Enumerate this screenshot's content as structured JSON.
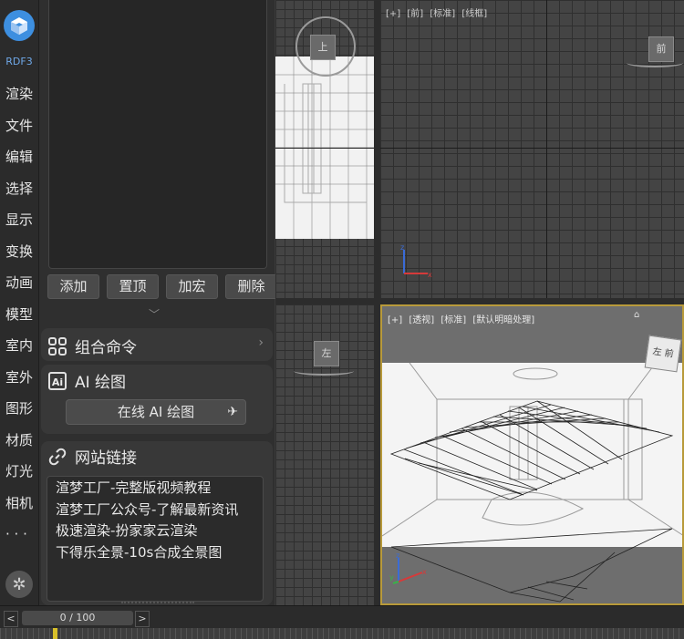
{
  "rail": {
    "version": "RDF3",
    "menu": [
      "渲染",
      "文件",
      "编辑",
      "选择",
      "显示",
      "变换",
      "动画",
      "模型",
      "室内",
      "室外",
      "图形",
      "材质",
      "灯光",
      "相机",
      "· · ·"
    ]
  },
  "panel": {
    "buttons": [
      "添加",
      "置顶",
      "加宏",
      "删除"
    ],
    "combo": {
      "title": "组合命令"
    },
    "ai": {
      "title": "AI 绘图",
      "badge": "Ai",
      "online_button": "在线 AI 绘图"
    },
    "links": {
      "title": "网站链接",
      "items": [
        "渲梦工厂-完整版视频教程",
        "渲梦工厂公众号-了解最新资讯",
        "极速渲染-扮家家云渲染",
        "下得乐全景-10s合成全景图"
      ]
    }
  },
  "viewports": {
    "top_right": {
      "labels": [
        "[+]",
        "[前]",
        "[标准]",
        "[线框]"
      ],
      "cube_label": "前"
    },
    "bottom_right": {
      "labels": [
        "[+]",
        "[透视]",
        "[标准]",
        "[默认明暗处理]"
      ],
      "cube_labels": [
        "左",
        "前"
      ]
    },
    "left_small_cube": "左",
    "top_left_cube": "上"
  },
  "timeline": {
    "frame": "0 / 100",
    "prev": "<",
    "next": ">"
  },
  "colors": {
    "accent": "#3d8fe0",
    "active_border": "#b89a3a",
    "time_cursor": "#d8c02a"
  }
}
